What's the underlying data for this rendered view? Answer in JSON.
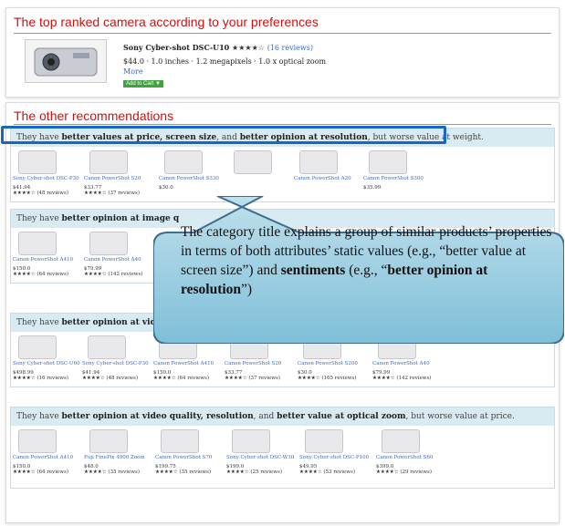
{
  "top": {
    "title": "The top ranked camera according to your preferences",
    "product_name": "Sony Cyber-shot DSC-U10",
    "stars": "★★★★☆",
    "reviews": "(16 reviews)",
    "description": "$44.0 · 1.0 inches · 1.2 megapixels · 1.0 x optical zoom",
    "more": "More",
    "add_to_cart": "Add to Cart ▼"
  },
  "other": {
    "title": "The other recommendations",
    "groups": [
      {
        "head_pre": "They have ",
        "head_bold1": "better values at price, screen size",
        "head_mid": ", and ",
        "head_bold2": "better opinion at resolution",
        "head_post": ", but worse value at weight.",
        "products": [
          {
            "name": "Sony Cyber-shot DSC-P30",
            "price": "$41.94",
            "rating": "★★★★☆ (48 reviews)"
          },
          {
            "name": "Canon PowerShot S20",
            "price": "$33.77",
            "rating": "★★★★☆ (37 reviews)"
          },
          {
            "name": "Canon PowerShot S330",
            "price": "$30.0",
            "rating": ""
          },
          {
            "name": "",
            "price": "",
            "rating": ""
          },
          {
            "name": "Canon PowerShot A20",
            "price": "",
            "rating": ""
          },
          {
            "name": "Canon PowerShot S300",
            "price": "$35.99",
            "rating": ""
          }
        ]
      },
      {
        "head_pre": "They have ",
        "head_bold1": "better opinion at image q",
        "head_mid": "",
        "head_bold2": "",
        "head_post": "",
        "products": [
          {
            "name": "Canon PowerShot A410",
            "price": "$150.0",
            "rating": "★★★★☆ (64 reviews)"
          },
          {
            "name": "Canon PowerShot A40",
            "price": "$79.99",
            "rating": "★★★★☆ (142 reviews)"
          }
        ]
      },
      {
        "head_pre": "They have ",
        "head_bold1": "better opinion at video qu",
        "head_mid": "",
        "head_bold2": "",
        "head_post": "",
        "products": [
          {
            "name": "Sony Cyber-shot DSC-U60",
            "price": "$498.99",
            "rating": "★★★★☆ (16 reviews)"
          },
          {
            "name": "Sony Cyber-shot DSC-P30",
            "price": "$41.94",
            "rating": "★★★★☆ (48 reviews)"
          },
          {
            "name": "Canon PowerShot A410",
            "price": "$150.0",
            "rating": "★★★★☆ (64 reviews)"
          },
          {
            "name": "Canon PowerShot S20",
            "price": "$33.77",
            "rating": "★★★★☆ (37 reviews)"
          },
          {
            "name": "Canon PowerShot S200",
            "price": "$30.0",
            "rating": "★★★★☆ (165 reviews)"
          },
          {
            "name": "Canon PowerShot A40",
            "price": "$79.99",
            "rating": "★★★★☆ (142 reviews)"
          }
        ]
      },
      {
        "head_pre": "They have ",
        "head_bold1": "better opinion at video quality, resolution",
        "head_mid": ", and ",
        "head_bold2": "better value at optical zoom",
        "head_post": ", but worse value at price.",
        "products": [
          {
            "name": "Canon PowerShot A410",
            "price": "$150.0",
            "rating": "★★★★☆ (64 reviews)"
          },
          {
            "name": "Fuji FinePix 4900 Zoom",
            "price": "$48.0",
            "rating": "★★★★☆ (35 reviews)"
          },
          {
            "name": "Canon PowerShot S70",
            "price": "$199.75",
            "rating": "★★★★☆ (35 reviews)"
          },
          {
            "name": "Sony Cyber-shot DSC-W30",
            "price": "$199.0",
            "rating": "★★★★☆ (25 reviews)"
          },
          {
            "name": "Sony Cyber-shot DSC-P100",
            "price": "$49.95",
            "rating": "★★★★☆ (53 reviews)"
          },
          {
            "name": "Canon PowerShot S60",
            "price": "$399.0",
            "rating": "★★★★☆ (29 reviews)"
          }
        ]
      }
    ]
  },
  "callout": {
    "text1": "The category title explains a group of similar products’ properties in terms of both attributes’ static values (e.g., “better value at screen size”) and ",
    "bold1": "sentiments",
    "text2": " (e.g., “",
    "bold2": "better opinion at resolution",
    "text3": "”)"
  }
}
